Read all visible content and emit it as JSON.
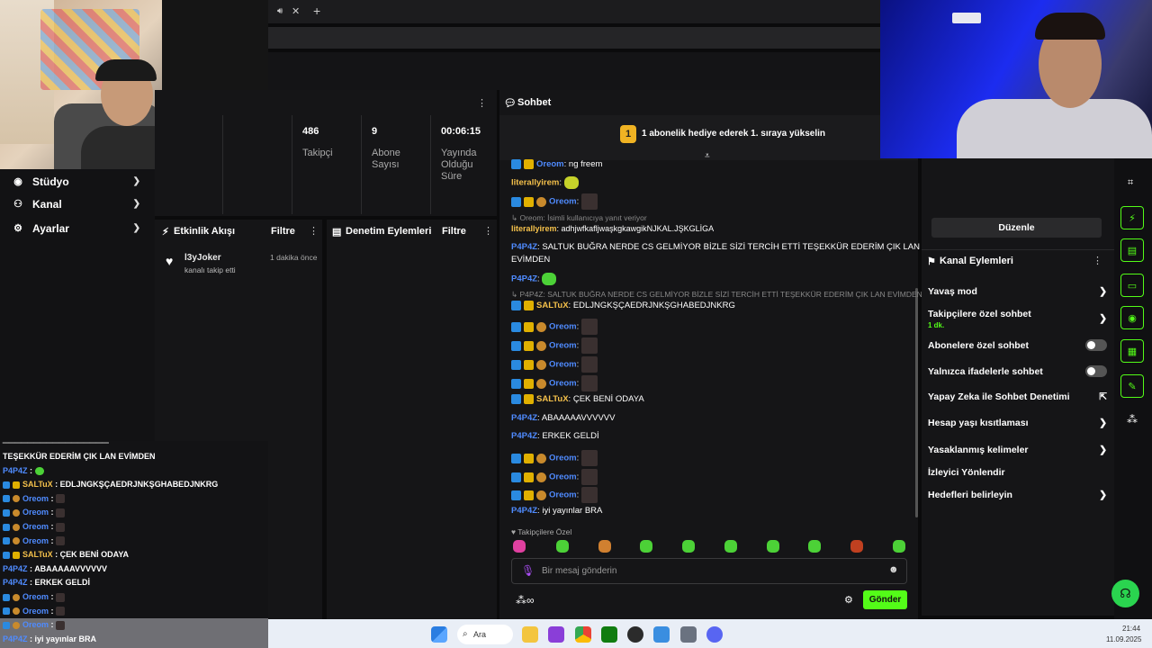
{
  "browser": {
    "tab_icons": [
      "speaker-icon",
      "close-icon",
      "plus-icon"
    ]
  },
  "sidebar": {
    "items": [
      {
        "label": "Stüdyo",
        "icon": "studio-icon"
      },
      {
        "label": "Kanal",
        "icon": "channel-icon"
      },
      {
        "label": "Ayarlar",
        "icon": "gear-icon"
      }
    ]
  },
  "stats": [
    {
      "value": "486",
      "label": "Takipçi"
    },
    {
      "value": "9",
      "label": "Abone Sayısı"
    },
    {
      "value": "00:06:15",
      "label": "Yayında Olduğu Süre"
    }
  ],
  "activity": {
    "title": "Etkinlik Akışı",
    "filter": "Filtre",
    "event_user": "l3yJoker",
    "event_text": "kanalı takip etti",
    "event_time": "1 dakika önce"
  },
  "moderation": {
    "title": "Denetim Eylemleri",
    "filter": "Filtre"
  },
  "chat": {
    "title": "Sohbet",
    "banner_num": "1",
    "banner_text": "1 abonelik hediye ederek 1. sıraya yükselin",
    "m0_user": "Oreom",
    "m0_text": "ng freem",
    "m1_user": "literallyirem",
    "m2_user": "Oreom",
    "reply_text": "Oreom: İsimli kullanıcıya yanıt veriyor",
    "m3_user": "literallyirem",
    "m3_text": "adhjwfkafljwaşkgkawgikNJKAL.JŞKGLİGA",
    "m4_user": "P4P4Z",
    "m4_text": "SALTUK BUĞRA NERDE CS GELMİYOR BİZLE SİZİ TERCİH ETTİ TEŞEKKÜR EDERİM ÇIK LAN",
    "m4_text2": "EVİMDEN",
    "m5_user": "P4P4Z",
    "reply2_text": "P4P4Z: SALTUK BUĞRA NERDE CS GELMİYOR BİZLE SİZİ TERCİH ETTİ TEŞEKKÜR EDERİM ÇIK LAN EVİMDEN...",
    "m6_user": "SALTuX",
    "m6_text": "EDLJNGKŞÇAEDRJNKŞGHABEDJNKRG",
    "m7_user": "Oreom",
    "m8_user": "Oreom",
    "m9_user": "Oreom",
    "m10_user": "Oreom",
    "m11_user": "SALTuX",
    "m11_text": "ÇEK BENİ ODAYA",
    "m12_user": "P4P4Z",
    "m12_text": "ABAAAAAVVVVVV",
    "m13_user": "P4P4Z",
    "m13_text": "ERKEK GELDİ",
    "m14_user": "Oreom",
    "m15_user": "Oreom",
    "m16_user": "Oreom",
    "m17_user": "P4P4Z",
    "m17_text": "iyi yayınlar BRA",
    "followers_only": "Takipçilere Özel",
    "input_placeholder": "Bir mesaj gönderin",
    "send": "Gönder"
  },
  "channel": {
    "edit": "Düzenle",
    "actions_title": "Kanal Eylemleri",
    "rows": [
      {
        "label": "Yavaş mod",
        "type": "chevron"
      },
      {
        "label": "Takipçilere özel sohbet",
        "sub": "1 dk.",
        "type": "chevron"
      },
      {
        "label": "Abonelere özel sohbet",
        "type": "toggle"
      },
      {
        "label": "Yalnızca ifadelerle sohbet",
        "type": "toggle"
      },
      {
        "label": "Yapay Zeka ile Sohbet Denetimi",
        "type": "external"
      },
      {
        "label": "Hesap yaşı kısıtlaması",
        "type": "chevron"
      },
      {
        "label": "Yasaklanmış kelimeler",
        "type": "chevron"
      },
      {
        "label": "İzleyici Yönlendir",
        "type": "none"
      },
      {
        "label": "Hedefleri belirleyin",
        "type": "chevron"
      }
    ]
  },
  "overlay": {
    "l0": "TEŞEKKÜR EDERİM ÇIK LAN EVİMDEN",
    "l1_user": "P4P4Z",
    "l2_user": "SALTuX",
    "l2_text": "EDLJNGKŞÇAEDRJNKŞGHABEDJNKRG",
    "l3_user": "Oreom",
    "l4_user": "Oreom",
    "l5_user": "Oreom",
    "l6_user": "Oreom",
    "l7_user": "SALTuX",
    "l7_text": "ÇEK BENİ ODAYA",
    "l8_user": "P4P4Z",
    "l8_text": "ABAAAAAVVVVVV",
    "l9_user": "P4P4Z",
    "l9_text": "ERKEK GELDİ",
    "l10_user": "Oreom",
    "l11_user": "Oreom",
    "l12_user": "Oreom",
    "l13_user": "P4P4Z",
    "l13_text": "iyi yayınlar BRA"
  },
  "taskbar": {
    "search": "Ara",
    "time": "21:44",
    "date": "11.09.2025"
  },
  "colors": {
    "accent": "#53fc18",
    "username_blue": "#4f8bff",
    "username_gold": "#f5c14b"
  }
}
